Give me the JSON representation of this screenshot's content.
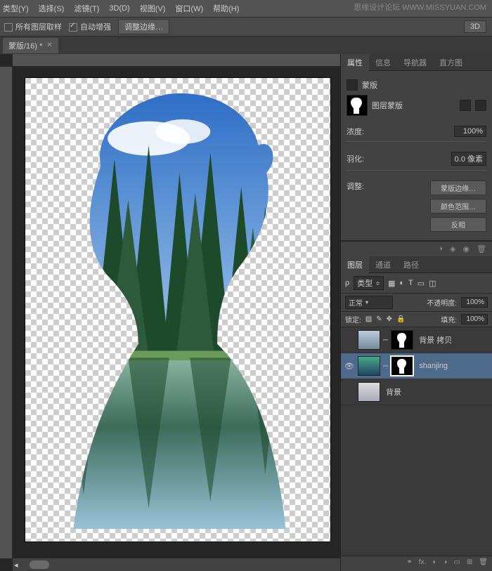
{
  "watermark": "思缘设计论坛  WWW.MISSYUAN.COM",
  "menu": {
    "type": "类型(Y)",
    "select": "选择(S)",
    "filter": "滤镜(T)",
    "threed": "3D(D)",
    "view": "视图(V)",
    "window": "窗口(W)",
    "help": "帮助(H)"
  },
  "optbar": {
    "sample": "所有图层取样",
    "enhance": "自动增强",
    "adjust": "调整边缘…",
    "btn3d": "3D"
  },
  "tab": {
    "name": "蒙版/16) *"
  },
  "panels": {
    "prop_tabs": {
      "prop": "属性",
      "info": "信息",
      "nav": "导航器",
      "hist": "直方图"
    },
    "mask_title": "蒙版",
    "layer_mask": "图层蒙版",
    "density_lbl": "浓度:",
    "density_val": "100%",
    "feather_lbl": "羽化:",
    "feather_val": "0.0 像素",
    "adjust_lbl": "调整:",
    "maskedge": "蒙版边缘…",
    "colorrange": "颜色范围…",
    "invert": "反相",
    "layer_tabs": {
      "layers": "图层",
      "channels": "通道",
      "paths": "路径"
    },
    "kind": "类型",
    "blend": "正常",
    "opacity_lbl": "不透明度:",
    "opacity_val": "100%",
    "lock_lbl": "锁定:",
    "fill_lbl": "填充:",
    "fill_val": "100%",
    "layers_list": [
      {
        "name": "背景 拷贝",
        "visible": false,
        "mask": true,
        "select": false
      },
      {
        "name": "shanjing",
        "visible": true,
        "mask": true,
        "select": true
      },
      {
        "name": "背景",
        "visible": false,
        "mask": false,
        "select": false
      }
    ],
    "footer": {
      "fx": "fx."
    }
  }
}
